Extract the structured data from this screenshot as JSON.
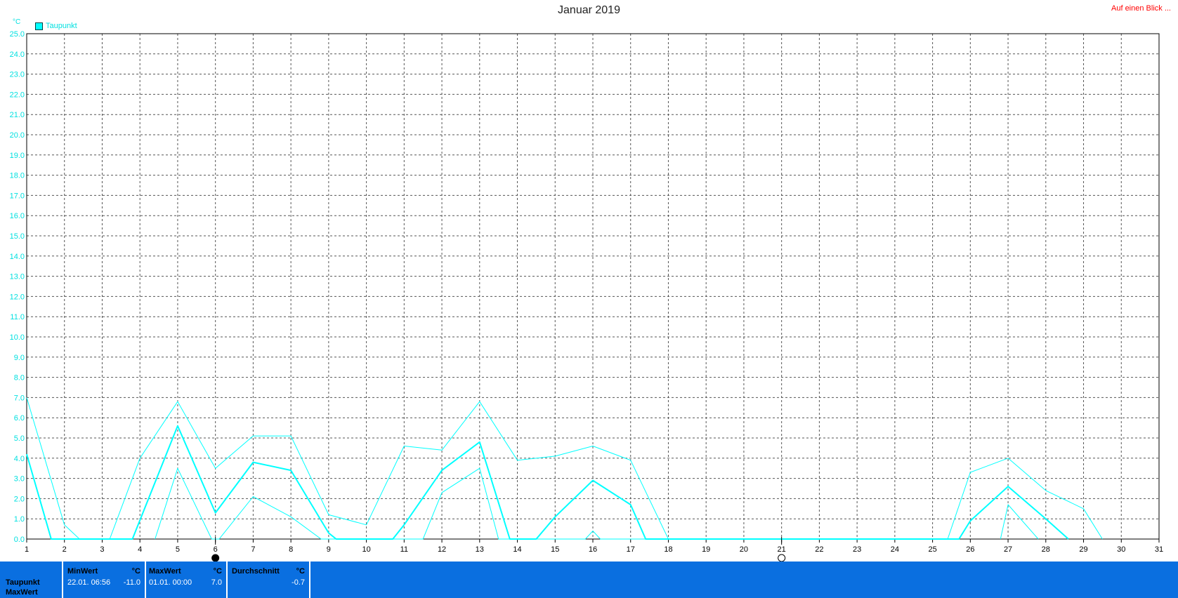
{
  "header": {
    "title": "Januar 2019",
    "link": "Auf einen Blick ..."
  },
  "legend": {
    "label": "Taupunkt",
    "color": "#00ffff"
  },
  "chart_data": {
    "type": "line",
    "title": "Januar 2019",
    "ylabel": "°C",
    "xlabel": "",
    "ylim": [
      0,
      25
    ],
    "xlim": [
      1,
      31
    ],
    "grid": true,
    "legend_position": "top-left",
    "x_ticks": [
      "1",
      "2",
      "3",
      "4",
      "5",
      "6",
      "7",
      "8",
      "9",
      "10",
      "11",
      "12",
      "13",
      "14",
      "15",
      "16",
      "17",
      "18",
      "19",
      "20",
      "21",
      "22",
      "23",
      "24",
      "25",
      "26",
      "27",
      "28",
      "29",
      "30",
      "31"
    ],
    "y_ticks": [
      "0.0",
      "1.0",
      "2.0",
      "3.0",
      "4.0",
      "5.0",
      "6.0",
      "7.0",
      "8.0",
      "9.0",
      "10.0",
      "11.0",
      "12.0",
      "13.0",
      "14.0",
      "15.0",
      "16.0",
      "17.0",
      "18.0",
      "19.0",
      "20.0",
      "21.0",
      "22.0",
      "23.0",
      "24.0",
      "25.0"
    ],
    "series": [
      {
        "name": "Taupunkt",
        "role": "max",
        "color": "#00ffff",
        "width": 1,
        "points": [
          [
            1,
            7.0
          ],
          [
            2,
            0.7
          ],
          [
            2.4,
            0
          ],
          [
            3.2,
            0
          ],
          [
            4,
            4.0
          ],
          [
            5,
            6.8
          ],
          [
            6,
            3.5
          ],
          [
            7,
            5.1
          ],
          [
            8,
            5.1
          ],
          [
            9,
            1.2
          ],
          [
            10,
            0.7
          ],
          [
            11,
            4.6
          ],
          [
            12,
            4.4
          ],
          [
            13,
            6.8
          ],
          [
            14,
            3.9
          ],
          [
            15,
            4.1
          ],
          [
            16,
            4.6
          ],
          [
            17,
            3.9
          ],
          [
            18,
            0
          ]
        ]
      },
      {
        "name": "Taupunkt",
        "role": "mean",
        "color": "#00ffff",
        "width": 2,
        "points": [
          [
            1,
            4.2
          ],
          [
            1.65,
            0
          ],
          [
            3.8,
            0
          ],
          [
            5,
            5.6
          ],
          [
            6,
            1.3
          ],
          [
            7,
            3.8
          ],
          [
            8,
            3.4
          ],
          [
            9,
            0.3
          ],
          [
            9.2,
            0
          ],
          [
            10.7,
            0
          ],
          [
            11,
            0.7
          ],
          [
            12,
            3.4
          ],
          [
            13,
            4.8
          ],
          [
            13.8,
            0
          ],
          [
            14.5,
            0
          ],
          [
            15,
            1.1
          ],
          [
            16,
            2.9
          ],
          [
            17,
            1.7
          ],
          [
            17.4,
            0
          ],
          [
            25.7,
            0
          ],
          [
            26,
            0.9
          ],
          [
            27,
            2.6
          ],
          [
            28,
            1.0
          ],
          [
            28.6,
            0
          ]
        ]
      },
      {
        "name": "Taupunkt",
        "role": "min",
        "color": "#00ffff",
        "width": 1,
        "points": [
          [
            4.4,
            0
          ],
          [
            5,
            3.5
          ],
          [
            5.9,
            0
          ],
          [
            6.1,
            0
          ],
          [
            7,
            2.1
          ],
          [
            8,
            1.1
          ],
          [
            8.8,
            0
          ],
          [
            11.5,
            0
          ],
          [
            12,
            2.3
          ],
          [
            13,
            3.5
          ],
          [
            13.5,
            0
          ],
          [
            15.8,
            0
          ],
          [
            16,
            0.4
          ],
          [
            16.2,
            0
          ],
          [
            25.4,
            0
          ],
          [
            26,
            3.3
          ],
          [
            27,
            4.0
          ],
          [
            28,
            2.4
          ],
          [
            29,
            1.5
          ],
          [
            29.5,
            0
          ]
        ]
      },
      {
        "name": "Taupunkt",
        "role": "min-low",
        "color": "#00ffff",
        "width": 1,
        "points": [
          [
            26.8,
            0
          ],
          [
            27,
            1.7
          ],
          [
            27.8,
            0
          ]
        ]
      }
    ],
    "markers": [
      {
        "day": 6,
        "symbol": "moon-new"
      },
      {
        "day": 21,
        "symbol": "moon-full"
      }
    ]
  },
  "stats": {
    "row_labels": [
      "Taupunkt",
      "MaxWert"
    ],
    "min": {
      "header": "MinWert",
      "unit": "°C",
      "time": "22.01.  06:56",
      "value": "-11.0"
    },
    "max": {
      "header": "MaxWert",
      "unit": "°C",
      "time": "01.01.  00:00",
      "value": "7.0"
    },
    "avg": {
      "header": "Durchschnitt",
      "unit": "°C",
      "value": "-0.7"
    }
  }
}
